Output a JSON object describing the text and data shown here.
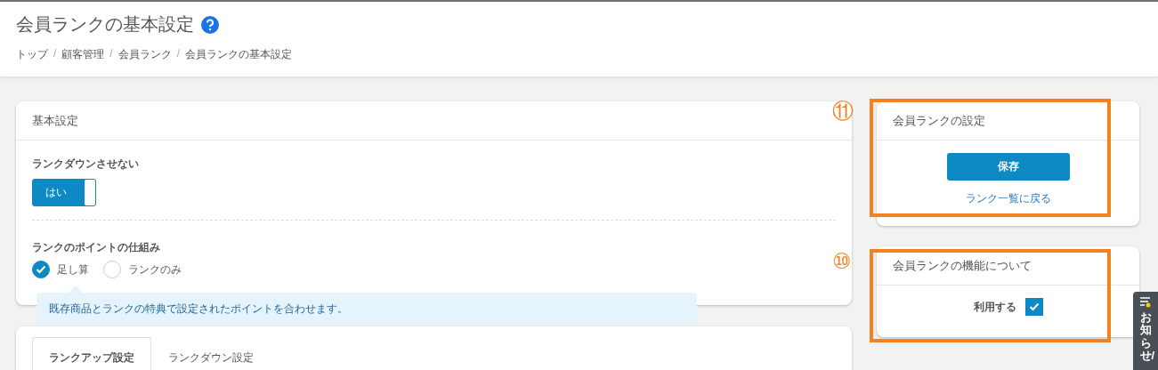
{
  "page": {
    "title": "会員ランクの基本設定"
  },
  "breadcrumbs": [
    "トップ",
    "顧客管理",
    "会員ランク",
    "会員ランクの基本設定"
  ],
  "breadcrumb_separator": "/",
  "basic_settings": {
    "title": "基本設定",
    "no_rank_down": {
      "label": "ランクダウンさせない",
      "toggle_label": "はい",
      "on": true
    },
    "point_scheme": {
      "label": "ランクのポイントの仕組み",
      "options": [
        {
          "label": "足し算",
          "selected": true
        },
        {
          "label": "ランクのみ",
          "selected": false
        }
      ],
      "tooltip": "既存商品とランクの特典で設定されたポイントを合わせます。"
    }
  },
  "rank_tabs": [
    {
      "label": "ランクアップ設定",
      "selected": true
    },
    {
      "label": "ランクダウン設定",
      "selected": false
    }
  ],
  "rank_settings": {
    "title": "会員ランクの設定",
    "save_button": "保存",
    "back_link": "ランク一覧に戻る",
    "annotation": "⑪"
  },
  "rank_feature": {
    "title": "会員ランクの機能について",
    "use_label": "利用する",
    "checked": true,
    "annotation": "⑩"
  },
  "notice_tab": {
    "label": "お知らせ/"
  }
}
